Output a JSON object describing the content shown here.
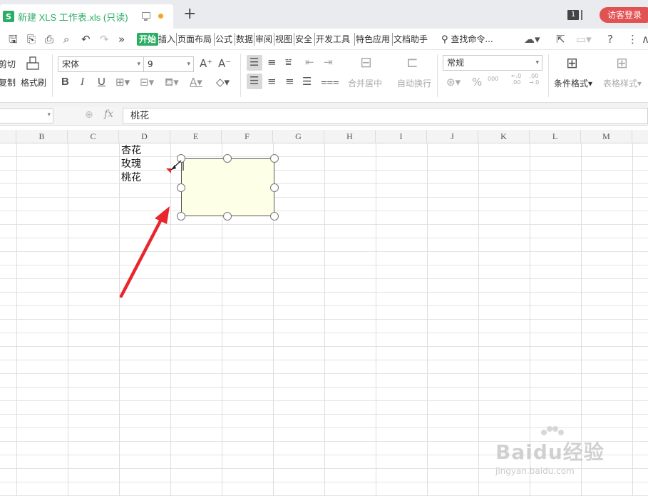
{
  "titlebar": {
    "doc_title": "新建 XLS 工作表.xls (只读)",
    "app_badge": "S",
    "new_tab": "+",
    "window_count": "1",
    "visitor_login": "访客登录"
  },
  "menu": {
    "tabs": [
      "开始",
      "插入",
      "页面布局",
      "公式",
      "数据",
      "审阅",
      "视图",
      "安全",
      "开发工具",
      "特色应用",
      "文档助手"
    ],
    "active_tab": "开始",
    "find_command": "查找命令...",
    "quick_access_more": "»"
  },
  "ribbon": {
    "cut_label": "剪切",
    "copy_label": "复制",
    "format_painter_label": "格式刷",
    "font_name": "宋体",
    "font_size": "9",
    "merge_center_label": "合并居中",
    "wrap_text_label": "自动换行",
    "number_format": "常规",
    "conditional_format_label": "条件格式",
    "table_style_label": "表格样式",
    "bold": "B",
    "italic": "I",
    "underline": "U",
    "font_grow": "A⁺",
    "font_shrink": "A⁻",
    "percent": "%",
    "thousands": "000",
    "decimal_increase": "←.0 .00",
    "decimal_decrease": ".00 →.0"
  },
  "formula_bar": {
    "name_box": "",
    "fx_label": "fx",
    "formula": "桃花"
  },
  "columns": [
    "B",
    "C",
    "D",
    "E",
    "F",
    "G",
    "H",
    "I",
    "J",
    "K",
    "L",
    "M"
  ],
  "cells": {
    "d1": "杏花",
    "d2": "玫瑰",
    "d3": "桃花"
  },
  "colors": {
    "accent_green": "#2bae64",
    "visitor_red": "#e35252",
    "comment_fill": "#fdffe6",
    "arrow_red": "#e8262d"
  },
  "watermark": {
    "logo": "Baidu经验",
    "url": "jingyan.baidu.com"
  }
}
